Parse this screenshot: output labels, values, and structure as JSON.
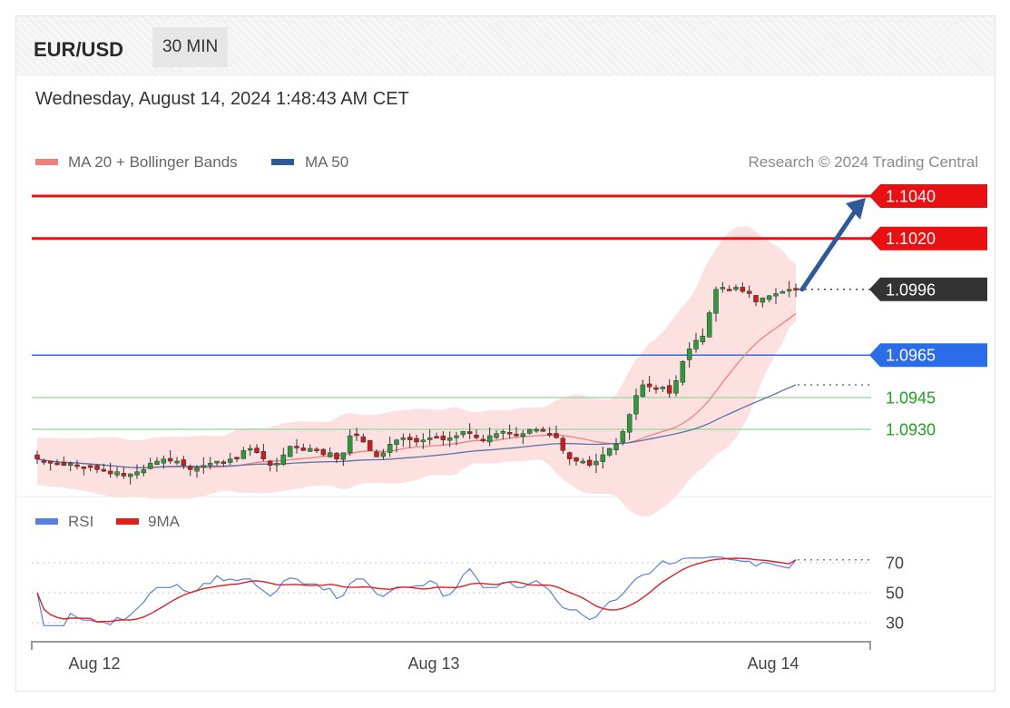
{
  "header": {
    "symbol": "EUR/USD",
    "timeframe": "30 MIN"
  },
  "timestamp": "Wednesday, August 14, 2024 1:48:43 AM CET",
  "legend": {
    "items": [
      {
        "label": "MA 20 + Bollinger Bands",
        "color": "#f08080"
      },
      {
        "label": "MA 50",
        "color": "#2e5a9a"
      }
    ],
    "credit": "Research © 2024 Trading Central"
  },
  "rsi_legend": [
    {
      "label": "RSI",
      "color": "#5b7fe0"
    },
    {
      "label": "9MA",
      "color": "#e02020"
    }
  ],
  "chart_data": {
    "type": "candlestick",
    "instrument": "EUR/USD",
    "interval": "30 MIN",
    "x_ticks": [
      "Aug 12",
      "Aug 13",
      "Aug 14"
    ],
    "price_levels": [
      {
        "value": "1.1040",
        "kind": "resistance",
        "color": "#e81010"
      },
      {
        "value": "1.1020",
        "kind": "resistance",
        "color": "#e81010"
      },
      {
        "value": "1.0996",
        "kind": "last",
        "color": "#333333"
      },
      {
        "value": "1.0965",
        "kind": "pivot",
        "color": "#2b6de8"
      },
      {
        "value": "1.0945",
        "kind": "support",
        "color": "#23a023"
      },
      {
        "value": "1.0930",
        "kind": "support",
        "color": "#23a023"
      }
    ],
    "price_ylim": [
      1.0905,
      1.1048
    ],
    "forecast_arrow": {
      "from": 1.0996,
      "to": 1.104
    },
    "close_series": [
      1.0916,
      1.0915,
      1.0914,
      1.0914,
      1.0913,
      1.0914,
      1.0913,
      1.0912,
      1.0912,
      1.0911,
      1.0911,
      1.0909,
      1.091,
      1.0908,
      1.0909,
      1.091,
      1.0911,
      1.0914,
      1.0915,
      1.0916,
      1.0915,
      1.0915,
      1.0913,
      1.0911,
      1.0912,
      1.0913,
      1.0914,
      1.0915,
      1.0914,
      1.0916,
      1.0916,
      1.092,
      1.0921,
      1.0919,
      1.0916,
      1.0913,
      1.0914,
      1.0918,
      1.0922,
      1.0922,
      1.092,
      1.0921,
      1.092,
      1.0918,
      1.0919,
      1.0916,
      1.0919,
      1.0927,
      1.0927,
      1.0924,
      1.092,
      1.0917,
      1.0919,
      1.0923,
      1.0925,
      1.0926,
      1.0925,
      1.0924,
      1.0925,
      1.0926,
      1.0926,
      1.0925,
      1.0926,
      1.0927,
      1.0929,
      1.0928,
      1.0926,
      1.0925,
      1.0927,
      1.0928,
      1.0929,
      1.0928,
      1.0927,
      1.0928,
      1.093,
      1.093,
      1.0929,
      1.0928,
      1.0926,
      1.092,
      1.0916,
      1.0915,
      1.0915,
      1.0913,
      1.0915,
      1.0918,
      1.0921,
      1.0923,
      1.0929,
      1.0937,
      1.0946,
      1.0951,
      1.095,
      1.0949,
      1.095,
      1.0947,
      1.0953,
      1.0962,
      1.0968,
      1.0972,
      1.0974,
      1.0985,
      1.0996,
      1.0997,
      1.0996,
      1.0997,
      1.0995,
      1.0994,
      1.099,
      1.0992,
      1.0993,
      1.0994,
      1.0995,
      1.0996,
      1.0996
    ],
    "ma20": {
      "start": 1.0912,
      "end": 1.0985
    },
    "ma50": {
      "start": 1.0915,
      "end": 1.0956
    },
    "rsi": {
      "ylim": [
        20,
        90
      ],
      "levels": [
        "70",
        "50",
        "30"
      ],
      "rsi_end": 72,
      "ma9_end": 72
    }
  }
}
